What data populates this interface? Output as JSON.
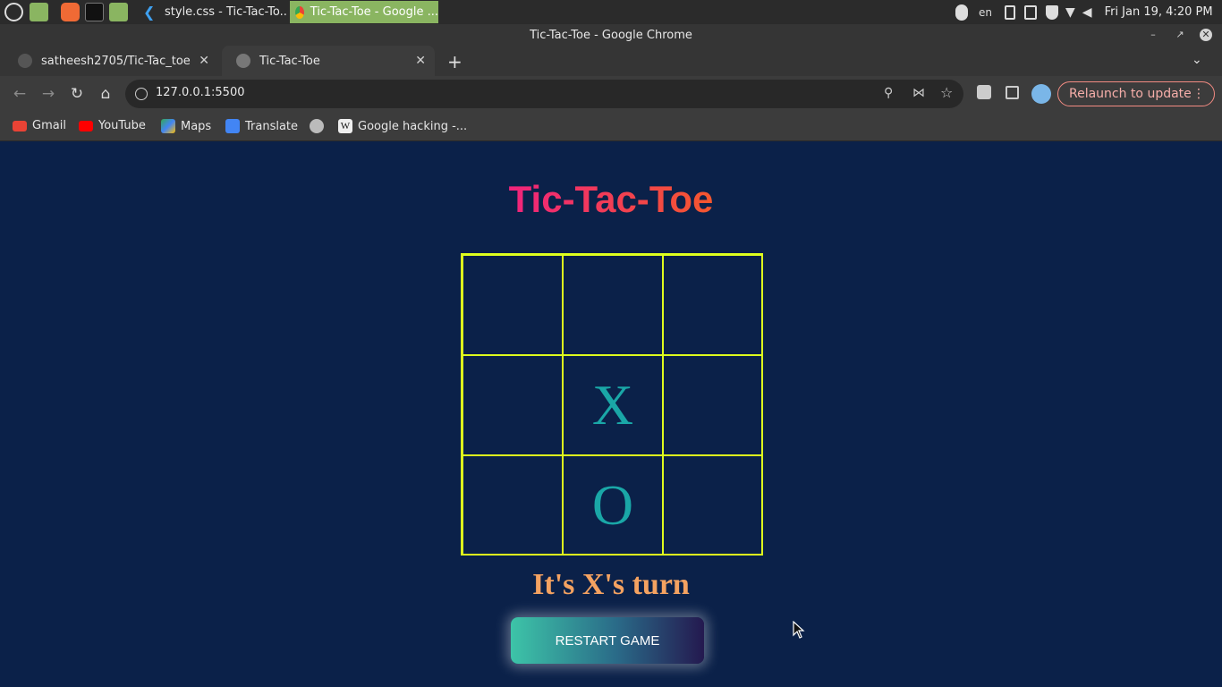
{
  "taskbar": {
    "tasks": [
      {
        "label": "style.css - Tic-Tac-To..."
      },
      {
        "label": "Tic-Tac-Toe - Google ..."
      }
    ],
    "lang": "en",
    "clock": "Fri Jan 19, 4:20 PM"
  },
  "window": {
    "title": "Tic-Tac-Toe - Google Chrome"
  },
  "tabs": [
    {
      "label": "satheesh2705/Tic-Tac_toe"
    },
    {
      "label": "Tic-Tac-Toe"
    }
  ],
  "toolbar": {
    "url": "127.0.0.1:5500",
    "relaunch_label": "Relaunch to update"
  },
  "bookmarks": [
    {
      "label": "Gmail"
    },
    {
      "label": "YouTube"
    },
    {
      "label": "Maps"
    },
    {
      "label": "Translate"
    },
    {
      "label": "Google hacking -..."
    }
  ],
  "game": {
    "title": "Tic-Tac-Toe",
    "cells": [
      "",
      "",
      "",
      "",
      "X",
      "",
      "",
      "O",
      ""
    ],
    "status": "It's X's turn",
    "restart_label": "RESTART GAME"
  },
  "colors": {
    "page_bg": "#0b2149",
    "grid_lines": "#dfff1d",
    "marks": "#1aa7a7",
    "status": "#f4a261",
    "title_gradient": [
      "#f0247c",
      "#f4572e"
    ]
  }
}
